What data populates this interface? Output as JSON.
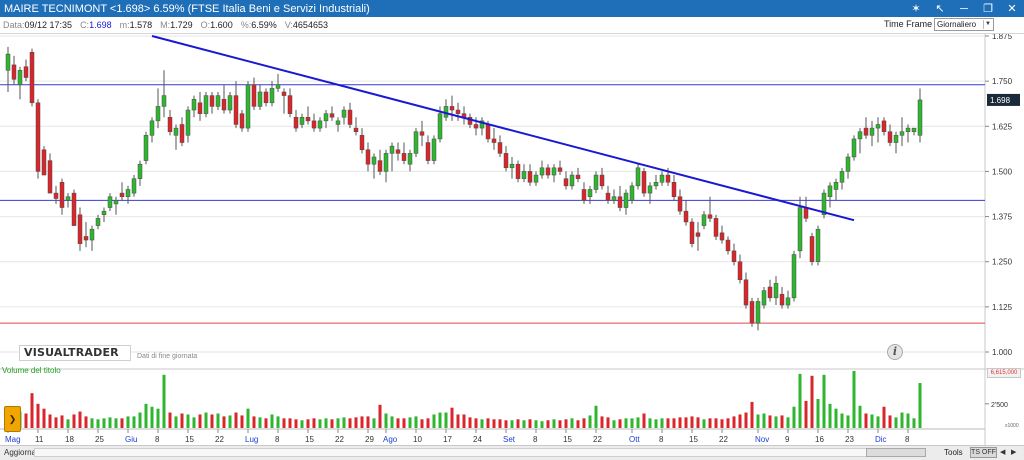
{
  "window": {
    "title": "MAIRE TECNIMONT <1.698> 6.59%  (FTSE Italia Beni e Servizi Industriali)"
  },
  "info": {
    "data_label": "Data:",
    "data_value": "09/12 17:35",
    "c_label": "C:",
    "c_value": "1.698",
    "m_label": "m:",
    "m_value": "1.578",
    "M_label": "M:",
    "M_value": "1.729",
    "o_label": "O:",
    "o_value": "1.600",
    "pct_label": "%:",
    "pct_value": "6.59%",
    "v_label": "V:",
    "v_value": "4654653"
  },
  "timeframe": {
    "label": "Time Frame",
    "selected": "Giornaliero"
  },
  "logo_text": "VISUALTRADER",
  "eod_text": "Dati di fine giornata",
  "volume": {
    "title": "Volume del titolo",
    "badge": "6,615,000",
    "axis_tick": "2'500",
    "axis_unit": "x1000"
  },
  "statusbar": {
    "aggiorna": "Aggiorna",
    "tools": "Tools",
    "ts_off": "TS OFF"
  },
  "icons": {
    "pin": "pin-icon",
    "back": "arrow-back-icon",
    "minimize": "minimize-icon",
    "restore": "restore-icon",
    "close": "close-icon",
    "info": "info-icon",
    "side_toggle": "expand-panel-icon"
  },
  "colors": {
    "up": "#2fb52f",
    "down": "#d8262b",
    "trendline": "#1919d2",
    "hline": "#3a3ad4",
    "support": "#e04848",
    "volume_title": "#1e9e1e"
  },
  "chart_data": {
    "type": "candlestick",
    "title": "MAIRE TECNIMONT",
    "price_axis": {
      "ticks": [
        "1.875",
        "1.750",
        "1.625",
        "1.500",
        "1.375",
        "1.250",
        "1.125",
        "1.000"
      ],
      "min": 1.0,
      "max": 1.875,
      "last_label": "1.698"
    },
    "x_labels": [
      {
        "i": 0,
        "text": "Mag",
        "month": true
      },
      {
        "i": 5,
        "text": "11"
      },
      {
        "i": 10,
        "text": "18"
      },
      {
        "i": 15,
        "text": "25"
      },
      {
        "i": 20,
        "text": "Giu",
        "month": true
      },
      {
        "i": 25,
        "text": "8"
      },
      {
        "i": 30,
        "text": "15"
      },
      {
        "i": 35,
        "text": "22"
      },
      {
        "i": 40,
        "text": "Lug",
        "month": true
      },
      {
        "i": 45,
        "text": "8"
      },
      {
        "i": 50,
        "text": "15"
      },
      {
        "i": 55,
        "text": "22"
      },
      {
        "i": 60,
        "text": "29"
      },
      {
        "i": 63,
        "text": "Ago",
        "month": true
      },
      {
        "i": 68,
        "text": "10"
      },
      {
        "i": 73,
        "text": "17"
      },
      {
        "i": 78,
        "text": "24"
      },
      {
        "i": 83,
        "text": "Set",
        "month": true
      },
      {
        "i": 88,
        "text": "8"
      },
      {
        "i": 93,
        "text": "15"
      },
      {
        "i": 98,
        "text": "22"
      },
      {
        "i": 104,
        "text": "Ott",
        "month": true
      },
      {
        "i": 109,
        "text": "8"
      },
      {
        "i": 114,
        "text": "15"
      },
      {
        "i": 119,
        "text": "22"
      },
      {
        "i": 125,
        "text": "Nov",
        "month": true
      },
      {
        "i": 130,
        "text": "9"
      },
      {
        "i": 135,
        "text": "16"
      },
      {
        "i": 140,
        "text": "23"
      },
      {
        "i": 145,
        "text": "Dic",
        "month": true
      },
      {
        "i": 150,
        "text": "8"
      }
    ],
    "horizontal_lines": [
      {
        "price": 1.74,
        "color": "#3a3ad4"
      },
      {
        "price": 1.42,
        "color": "#3a3ad4"
      },
      {
        "price": 1.08,
        "color": "#e04848"
      }
    ],
    "trendline": {
      "from": {
        "i": 24,
        "price": 1.875
      },
      "to": {
        "i": 141,
        "price": 1.365
      }
    },
    "candles": [
      [
        1.78,
        1.845,
        1.72,
        1.825,
        2.0
      ],
      [
        1.795,
        1.82,
        1.74,
        1.755,
        1.6
      ],
      [
        1.74,
        1.79,
        1.7,
        1.78,
        1.7
      ],
      [
        1.79,
        1.81,
        1.75,
        1.76,
        1.5
      ],
      [
        1.83,
        1.84,
        1.68,
        1.69,
        3.6
      ],
      [
        1.69,
        1.7,
        1.48,
        1.5,
        2.5
      ],
      [
        1.56,
        1.57,
        1.49,
        1.49,
        2.0
      ],
      [
        1.53,
        1.55,
        1.44,
        1.44,
        1.4
      ],
      [
        1.44,
        1.46,
        1.41,
        1.425,
        1.1
      ],
      [
        1.47,
        1.48,
        1.38,
        1.4,
        1.3
      ],
      [
        1.42,
        1.44,
        1.4,
        1.43,
        0.9
      ],
      [
        1.44,
        1.45,
        1.35,
        1.35,
        1.4
      ],
      [
        1.38,
        1.4,
        1.28,
        1.3,
        1.7
      ],
      [
        1.32,
        1.36,
        1.29,
        1.31,
        1.2
      ],
      [
        1.31,
        1.35,
        1.28,
        1.34,
        1.0
      ],
      [
        1.35,
        1.38,
        1.34,
        1.37,
        0.9
      ],
      [
        1.38,
        1.4,
        1.36,
        1.39,
        1.0
      ],
      [
        1.4,
        1.44,
        1.39,
        1.43,
        1.1
      ],
      [
        1.41,
        1.43,
        1.38,
        1.42,
        1.0
      ],
      [
        1.44,
        1.47,
        1.42,
        1.43,
        1.0
      ],
      [
        1.43,
        1.46,
        1.41,
        1.45,
        1.2
      ],
      [
        1.44,
        1.49,
        1.43,
        1.48,
        1.2
      ],
      [
        1.48,
        1.53,
        1.46,
        1.52,
        1.6
      ],
      [
        1.53,
        1.61,
        1.52,
        1.6,
        2.5
      ],
      [
        1.6,
        1.65,
        1.58,
        1.64,
        2.2
      ],
      [
        1.64,
        1.73,
        1.62,
        1.68,
        2.0
      ],
      [
        1.68,
        1.78,
        1.65,
        1.71,
        5.5
      ],
      [
        1.65,
        1.67,
        1.6,
        1.61,
        1.6
      ],
      [
        1.6,
        1.63,
        1.56,
        1.62,
        1.2
      ],
      [
        1.63,
        1.65,
        1.57,
        1.58,
        1.5
      ],
      [
        1.6,
        1.68,
        1.58,
        1.67,
        1.4
      ],
      [
        1.67,
        1.71,
        1.65,
        1.7,
        1.1
      ],
      [
        1.69,
        1.72,
        1.64,
        1.66,
        1.4
      ],
      [
        1.66,
        1.72,
        1.65,
        1.71,
        1.6
      ],
      [
        1.71,
        1.72,
        1.66,
        1.68,
        1.4
      ],
      [
        1.68,
        1.72,
        1.67,
        1.71,
        1.5
      ],
      [
        1.7,
        1.74,
        1.66,
        1.67,
        1.2
      ],
      [
        1.67,
        1.72,
        1.66,
        1.71,
        1.3
      ],
      [
        1.71,
        1.75,
        1.62,
        1.63,
        1.6
      ],
      [
        1.66,
        1.67,
        1.61,
        1.62,
        1.3
      ],
      [
        1.62,
        1.75,
        1.61,
        1.74,
        2.0
      ],
      [
        1.74,
        1.76,
        1.67,
        1.68,
        1.2
      ],
      [
        1.68,
        1.74,
        1.67,
        1.72,
        1.1
      ],
      [
        1.72,
        1.73,
        1.68,
        1.69,
        1.0
      ],
      [
        1.69,
        1.75,
        1.68,
        1.73,
        1.4
      ],
      [
        1.73,
        1.77,
        1.72,
        1.74,
        1.2
      ],
      [
        1.72,
        1.73,
        1.66,
        1.71,
        1.0
      ],
      [
        1.71,
        1.73,
        1.65,
        1.66,
        1.0
      ],
      [
        1.65,
        1.67,
        1.61,
        1.62,
        0.9
      ],
      [
        1.63,
        1.66,
        1.62,
        1.65,
        0.8
      ],
      [
        1.65,
        1.68,
        1.63,
        1.64,
        0.9
      ],
      [
        1.64,
        1.66,
        1.61,
        1.62,
        1.0
      ],
      [
        1.62,
        1.65,
        1.61,
        1.64,
        0.9
      ],
      [
        1.64,
        1.67,
        1.62,
        1.66,
        1.0
      ],
      [
        1.66,
        1.68,
        1.64,
        1.65,
        0.9
      ],
      [
        1.63,
        1.65,
        1.61,
        1.64,
        1.0
      ],
      [
        1.65,
        1.68,
        1.63,
        1.67,
        1.1
      ],
      [
        1.67,
        1.69,
        1.62,
        1.63,
        1.0
      ],
      [
        1.62,
        1.65,
        1.6,
        1.61,
        1.1
      ],
      [
        1.6,
        1.62,
        1.55,
        1.56,
        1.2
      ],
      [
        1.56,
        1.58,
        1.5,
        1.52,
        1.2
      ],
      [
        1.52,
        1.55,
        1.48,
        1.54,
        1.0
      ],
      [
        1.53,
        1.56,
        1.49,
        1.5,
        2.4
      ],
      [
        1.5,
        1.56,
        1.47,
        1.55,
        1.5
      ],
      [
        1.55,
        1.58,
        1.5,
        1.57,
        1.2
      ],
      [
        1.56,
        1.58,
        1.53,
        1.55,
        1.0
      ],
      [
        1.55,
        1.58,
        1.52,
        1.53,
        1.0
      ],
      [
        1.52,
        1.56,
        1.5,
        1.55,
        1.1
      ],
      [
        1.55,
        1.62,
        1.54,
        1.61,
        1.2
      ],
      [
        1.61,
        1.64,
        1.57,
        1.6,
        0.9
      ],
      [
        1.58,
        1.6,
        1.52,
        1.53,
        1.0
      ],
      [
        1.53,
        1.6,
        1.52,
        1.59,
        1.4
      ],
      [
        1.59,
        1.68,
        1.58,
        1.66,
        1.6
      ],
      [
        1.65,
        1.7,
        1.64,
        1.68,
        1.6
      ],
      [
        1.68,
        1.71,
        1.64,
        1.67,
        2.1
      ],
      [
        1.67,
        1.69,
        1.64,
        1.66,
        1.4
      ],
      [
        1.66,
        1.68,
        1.63,
        1.65,
        1.4
      ],
      [
        1.65,
        1.66,
        1.62,
        1.63,
        1.1
      ],
      [
        1.63,
        1.65,
        1.6,
        1.62,
        1.0
      ],
      [
        1.62,
        1.65,
        1.6,
        1.64,
        0.9
      ],
      [
        1.63,
        1.64,
        1.58,
        1.59,
        1.0
      ],
      [
        1.59,
        1.62,
        1.56,
        1.58,
        0.9
      ],
      [
        1.58,
        1.6,
        1.54,
        1.55,
        0.9
      ],
      [
        1.55,
        1.57,
        1.5,
        1.51,
        0.8
      ],
      [
        1.51,
        1.54,
        1.48,
        1.52,
        0.8
      ],
      [
        1.52,
        1.53,
        1.47,
        1.48,
        0.9
      ],
      [
        1.48,
        1.52,
        1.47,
        1.5,
        0.8
      ],
      [
        1.5,
        1.52,
        1.46,
        1.47,
        0.9
      ],
      [
        1.47,
        1.5,
        1.46,
        1.49,
        0.8
      ],
      [
        1.49,
        1.53,
        1.48,
        1.51,
        0.7
      ],
      [
        1.51,
        1.52,
        1.48,
        1.49,
        0.8
      ],
      [
        1.49,
        1.52,
        1.47,
        1.51,
        0.9
      ],
      [
        1.51,
        1.53,
        1.49,
        1.5,
        0.8
      ],
      [
        1.48,
        1.5,
        1.45,
        1.46,
        0.9
      ],
      [
        1.46,
        1.5,
        1.45,
        1.49,
        1.0
      ],
      [
        1.49,
        1.51,
        1.47,
        1.48,
        0.8
      ],
      [
        1.45,
        1.47,
        1.41,
        1.42,
        1.0
      ],
      [
        1.43,
        1.46,
        1.41,
        1.45,
        1.3
      ],
      [
        1.45,
        1.5,
        1.44,
        1.49,
        2.3
      ],
      [
        1.49,
        1.51,
        1.45,
        1.46,
        1.2
      ],
      [
        1.44,
        1.46,
        1.41,
        1.42,
        1.1
      ],
      [
        1.42,
        1.45,
        1.41,
        1.43,
        0.8
      ],
      [
        1.43,
        1.46,
        1.39,
        1.4,
        0.9
      ],
      [
        1.4,
        1.45,
        1.38,
        1.44,
        1.0
      ],
      [
        1.42,
        1.47,
        1.41,
        1.46,
        1.0
      ],
      [
        1.46,
        1.52,
        1.45,
        1.51,
        1.1
      ],
      [
        1.5,
        1.51,
        1.43,
        1.44,
        1.5
      ],
      [
        1.44,
        1.47,
        1.41,
        1.46,
        1.0
      ],
      [
        1.46,
        1.49,
        1.45,
        1.47,
        0.9
      ],
      [
        1.47,
        1.5,
        1.46,
        1.49,
        1.0
      ],
      [
        1.49,
        1.51,
        1.46,
        1.47,
        1.0
      ],
      [
        1.47,
        1.49,
        1.42,
        1.43,
        1.0
      ],
      [
        1.43,
        1.45,
        1.38,
        1.39,
        1.1
      ],
      [
        1.39,
        1.42,
        1.35,
        1.36,
        1.1
      ],
      [
        1.36,
        1.37,
        1.29,
        1.3,
        1.2
      ],
      [
        1.33,
        1.36,
        1.28,
        1.32,
        1.1
      ],
      [
        1.35,
        1.39,
        1.34,
        1.38,
        0.9
      ],
      [
        1.38,
        1.43,
        1.36,
        1.37,
        1.0
      ],
      [
        1.37,
        1.38,
        1.31,
        1.32,
        1.0
      ],
      [
        1.33,
        1.35,
        1.3,
        1.31,
        0.9
      ],
      [
        1.31,
        1.32,
        1.27,
        1.28,
        1.0
      ],
      [
        1.28,
        1.3,
        1.24,
        1.25,
        1.2
      ],
      [
        1.25,
        1.27,
        1.19,
        1.2,
        1.4
      ],
      [
        1.2,
        1.22,
        1.12,
        1.13,
        1.6
      ],
      [
        1.14,
        1.15,
        1.07,
        1.08,
        2.7
      ],
      [
        1.08,
        1.15,
        1.06,
        1.14,
        1.4
      ],
      [
        1.13,
        1.18,
        1.12,
        1.17,
        1.5
      ],
      [
        1.18,
        1.2,
        1.14,
        1.15,
        1.3
      ],
      [
        1.15,
        1.21,
        1.13,
        1.19,
        1.2
      ],
      [
        1.16,
        1.18,
        1.12,
        1.13,
        1.3
      ],
      [
        1.13,
        1.17,
        1.12,
        1.15,
        1.1
      ],
      [
        1.15,
        1.28,
        1.14,
        1.27,
        2.2
      ],
      [
        1.28,
        1.43,
        1.26,
        1.4,
        5.6
      ],
      [
        1.4,
        1.43,
        1.36,
        1.37,
        2.8
      ],
      [
        1.32,
        1.33,
        1.24,
        1.25,
        5.4
      ],
      [
        1.25,
        1.35,
        1.24,
        1.34,
        3.0
      ],
      [
        1.38,
        1.45,
        1.37,
        1.44,
        5.5
      ],
      [
        1.43,
        1.47,
        1.4,
        1.46,
        2.5
      ],
      [
        1.45,
        1.48,
        1.42,
        1.47,
        2.0
      ],
      [
        1.47,
        1.51,
        1.45,
        1.5,
        1.5
      ],
      [
        1.5,
        1.55,
        1.48,
        1.54,
        1.3
      ],
      [
        1.54,
        1.6,
        1.53,
        1.59,
        5.9
      ],
      [
        1.59,
        1.62,
        1.55,
        1.61,
        2.3
      ],
      [
        1.62,
        1.65,
        1.59,
        1.6,
        1.5
      ],
      [
        1.6,
        1.64,
        1.57,
        1.62,
        1.4
      ],
      [
        1.62,
        1.65,
        1.58,
        1.63,
        1.2
      ],
      [
        1.64,
        1.65,
        1.6,
        1.61,
        2.2
      ],
      [
        1.61,
        1.63,
        1.57,
        1.58,
        1.3
      ],
      [
        1.58,
        1.61,
        1.55,
        1.6,
        1.1
      ],
      [
        1.6,
        1.65,
        1.57,
        1.61,
        1.6
      ],
      [
        1.61,
        1.63,
        1.58,
        1.62,
        1.5
      ],
      [
        1.61,
        1.62,
        1.6,
        1.62,
        1.0
      ],
      [
        1.6,
        1.73,
        1.58,
        1.698,
        4.65
      ]
    ]
  }
}
